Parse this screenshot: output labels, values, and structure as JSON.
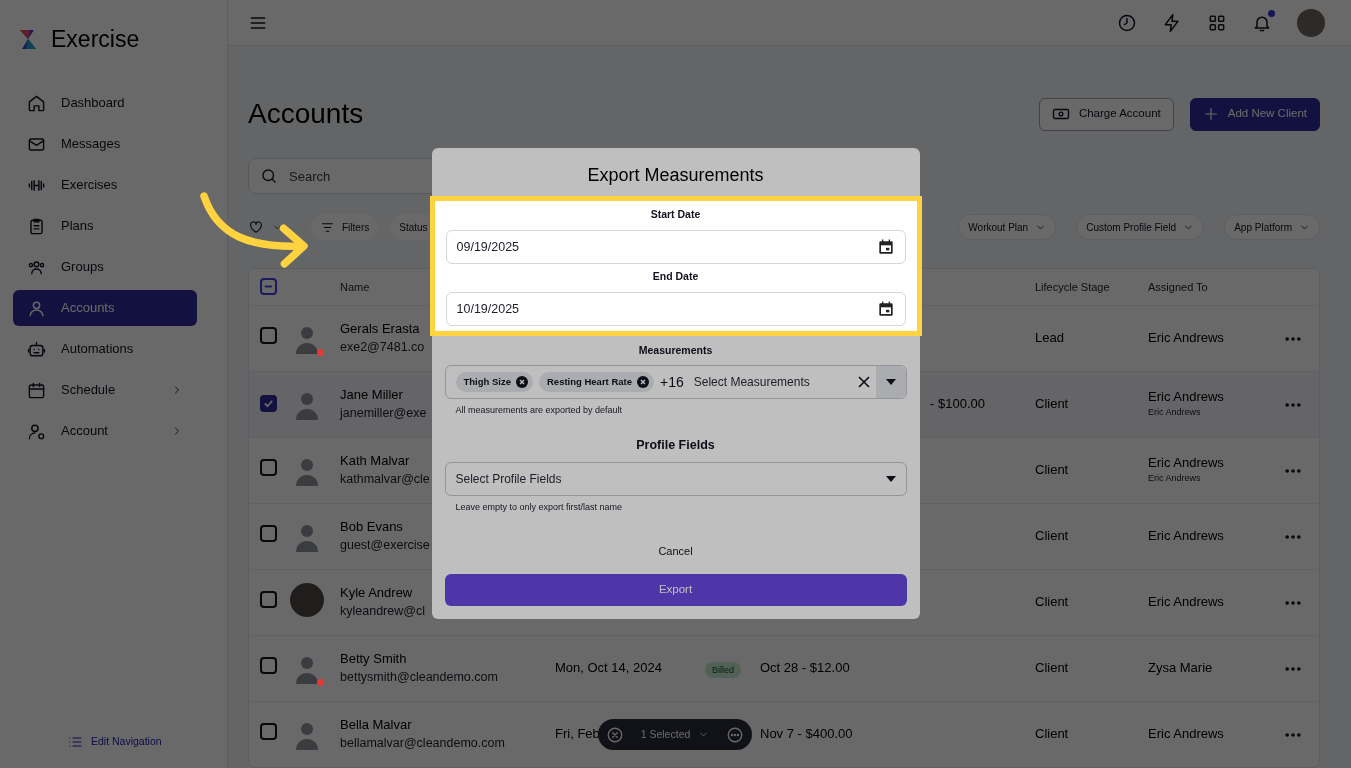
{
  "app": {
    "name": "Exercise"
  },
  "sidebar": {
    "items": [
      {
        "label": "Dashboard",
        "selected": false,
        "has_submenu": false
      },
      {
        "label": "Messages",
        "selected": false,
        "has_submenu": false
      },
      {
        "label": "Exercises",
        "selected": false,
        "has_submenu": false
      },
      {
        "label": "Plans",
        "selected": false,
        "has_submenu": false
      },
      {
        "label": "Groups",
        "selected": false,
        "has_submenu": false
      },
      {
        "label": "Accounts",
        "selected": true,
        "has_submenu": false
      },
      {
        "label": "Automations",
        "selected": false,
        "has_submenu": false
      },
      {
        "label": "Schedule",
        "selected": false,
        "has_submenu": true
      },
      {
        "label": "Account",
        "selected": false,
        "has_submenu": true
      }
    ],
    "edit_navigation": "Edit Navigation"
  },
  "topbar": {
    "notifications_unread": true
  },
  "page": {
    "title": "Accounts",
    "buttons": [
      {
        "kind": "outline",
        "label": "Charge Account"
      },
      {
        "kind": "primary",
        "label": "Add New Client"
      }
    ]
  },
  "search": {
    "placeholder": "Search"
  },
  "filters": [
    {
      "kind": "favorites"
    },
    {
      "kind": "filters",
      "label": "Filters"
    },
    {
      "kind": "plain",
      "label": "Status"
    },
    {
      "kind": "spacer"
    },
    {
      "kind": "dropdown",
      "label": "Workout Plan"
    },
    {
      "kind": "dropdown",
      "label": "Custom Profile Field"
    },
    {
      "kind": "dropdown",
      "label": "App Platform"
    }
  ],
  "table": {
    "select_all_partial": true,
    "columns": [
      "Name",
      "Lifecycle Stage",
      "Assigned To"
    ],
    "rows": [
      {
        "name": "Gerals Erasta",
        "email": "exe2@7481.co",
        "selected": false,
        "photo": false,
        "color": "#e53935",
        "lifecycle": "Lead",
        "assigned_to": "Eric Andrews"
      },
      {
        "name": "Jane Miller",
        "email": "janemiller@exe",
        "selected": true,
        "photo": false,
        "billing": "- $100.00",
        "billing_cut": true,
        "lifecycle": "Client",
        "assigned_to": "Eric Andrews",
        "assigned_sub": "Eric Andrews"
      },
      {
        "name": "Kath Malvar",
        "email": "kathmalvar@cle",
        "selected": false,
        "photo": false,
        "lifecycle": "Client",
        "assigned_to": "Eric Andrews",
        "assigned_sub": "Eric Andrews"
      },
      {
        "name": "Bob Evans",
        "email": "guest@exercise",
        "selected": false,
        "photo": false,
        "lifecycle": "Client",
        "assigned_to": "Eric Andrews"
      },
      {
        "name": "Kyle Andrew",
        "email": "kyleandrew@cl",
        "selected": false,
        "photo": true,
        "lifecycle": "Client",
        "assigned_to": "Eric Andrews"
      },
      {
        "name": "Betty Smith",
        "email": "bettysmith@cleandemo.com",
        "selected": false,
        "photo": false,
        "color": "#e53935",
        "last_date": "Mon, Oct 14, 2024",
        "badge": "Billed",
        "billing": "Oct 28 - $12.00",
        "lifecycle": "Client",
        "assigned_to": "Zysa Marie"
      },
      {
        "name": "Bella Malvar",
        "email": "bellamalvar@cleandemo.com",
        "selected": false,
        "photo": false,
        "last_date": "Fri, Feb",
        "billing": "Nov 7 - $400.00",
        "lifecycle": "Client",
        "assigned_to": "Eric Andrews"
      }
    ]
  },
  "selection_bar": {
    "label": "1 Selected"
  },
  "modal": {
    "title": "Export Measurements",
    "start_date": {
      "label": "Start Date",
      "value": "09/19/2025"
    },
    "end_date": {
      "label": "End Date",
      "value": "10/19/2025"
    },
    "measurements": {
      "label": "Measurements",
      "chips": [
        "Thigh Size",
        "Resting Heart Rate"
      ],
      "more": "+16",
      "placeholder": "Select Measurements",
      "help": "All measurements are exported by default"
    },
    "profile_fields": {
      "label": "Profile Fields",
      "placeholder": "Select Profile Fields",
      "help": "Leave empty to only export first/last name"
    },
    "cancel": "Cancel",
    "export": "Export"
  }
}
